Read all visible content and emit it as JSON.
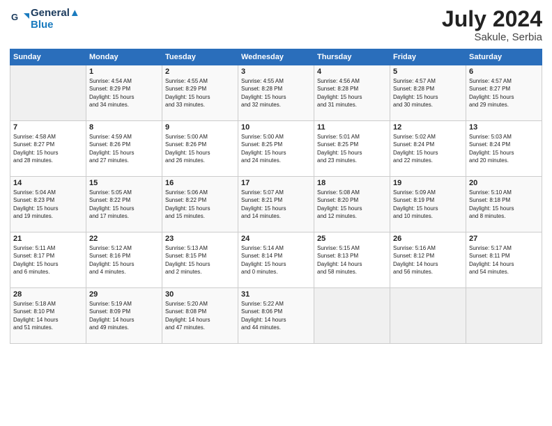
{
  "header": {
    "logo_line1": "General",
    "logo_line2": "Blue",
    "month_year": "July 2024",
    "location": "Sakule, Serbia"
  },
  "columns": [
    "Sunday",
    "Monday",
    "Tuesday",
    "Wednesday",
    "Thursday",
    "Friday",
    "Saturday"
  ],
  "weeks": [
    [
      {
        "day": "",
        "info": ""
      },
      {
        "day": "1",
        "info": "Sunrise: 4:54 AM\nSunset: 8:29 PM\nDaylight: 15 hours\nand 34 minutes."
      },
      {
        "day": "2",
        "info": "Sunrise: 4:55 AM\nSunset: 8:29 PM\nDaylight: 15 hours\nand 33 minutes."
      },
      {
        "day": "3",
        "info": "Sunrise: 4:55 AM\nSunset: 8:28 PM\nDaylight: 15 hours\nand 32 minutes."
      },
      {
        "day": "4",
        "info": "Sunrise: 4:56 AM\nSunset: 8:28 PM\nDaylight: 15 hours\nand 31 minutes."
      },
      {
        "day": "5",
        "info": "Sunrise: 4:57 AM\nSunset: 8:28 PM\nDaylight: 15 hours\nand 30 minutes."
      },
      {
        "day": "6",
        "info": "Sunrise: 4:57 AM\nSunset: 8:27 PM\nDaylight: 15 hours\nand 29 minutes."
      }
    ],
    [
      {
        "day": "7",
        "info": "Sunrise: 4:58 AM\nSunset: 8:27 PM\nDaylight: 15 hours\nand 28 minutes."
      },
      {
        "day": "8",
        "info": "Sunrise: 4:59 AM\nSunset: 8:26 PM\nDaylight: 15 hours\nand 27 minutes."
      },
      {
        "day": "9",
        "info": "Sunrise: 5:00 AM\nSunset: 8:26 PM\nDaylight: 15 hours\nand 26 minutes."
      },
      {
        "day": "10",
        "info": "Sunrise: 5:00 AM\nSunset: 8:25 PM\nDaylight: 15 hours\nand 24 minutes."
      },
      {
        "day": "11",
        "info": "Sunrise: 5:01 AM\nSunset: 8:25 PM\nDaylight: 15 hours\nand 23 minutes."
      },
      {
        "day": "12",
        "info": "Sunrise: 5:02 AM\nSunset: 8:24 PM\nDaylight: 15 hours\nand 22 minutes."
      },
      {
        "day": "13",
        "info": "Sunrise: 5:03 AM\nSunset: 8:24 PM\nDaylight: 15 hours\nand 20 minutes."
      }
    ],
    [
      {
        "day": "14",
        "info": "Sunrise: 5:04 AM\nSunset: 8:23 PM\nDaylight: 15 hours\nand 19 minutes."
      },
      {
        "day": "15",
        "info": "Sunrise: 5:05 AM\nSunset: 8:22 PM\nDaylight: 15 hours\nand 17 minutes."
      },
      {
        "day": "16",
        "info": "Sunrise: 5:06 AM\nSunset: 8:22 PM\nDaylight: 15 hours\nand 15 minutes."
      },
      {
        "day": "17",
        "info": "Sunrise: 5:07 AM\nSunset: 8:21 PM\nDaylight: 15 hours\nand 14 minutes."
      },
      {
        "day": "18",
        "info": "Sunrise: 5:08 AM\nSunset: 8:20 PM\nDaylight: 15 hours\nand 12 minutes."
      },
      {
        "day": "19",
        "info": "Sunrise: 5:09 AM\nSunset: 8:19 PM\nDaylight: 15 hours\nand 10 minutes."
      },
      {
        "day": "20",
        "info": "Sunrise: 5:10 AM\nSunset: 8:18 PM\nDaylight: 15 hours\nand 8 minutes."
      }
    ],
    [
      {
        "day": "21",
        "info": "Sunrise: 5:11 AM\nSunset: 8:17 PM\nDaylight: 15 hours\nand 6 minutes."
      },
      {
        "day": "22",
        "info": "Sunrise: 5:12 AM\nSunset: 8:16 PM\nDaylight: 15 hours\nand 4 minutes."
      },
      {
        "day": "23",
        "info": "Sunrise: 5:13 AM\nSunset: 8:15 PM\nDaylight: 15 hours\nand 2 minutes."
      },
      {
        "day": "24",
        "info": "Sunrise: 5:14 AM\nSunset: 8:14 PM\nDaylight: 15 hours\nand 0 minutes."
      },
      {
        "day": "25",
        "info": "Sunrise: 5:15 AM\nSunset: 8:13 PM\nDaylight: 14 hours\nand 58 minutes."
      },
      {
        "day": "26",
        "info": "Sunrise: 5:16 AM\nSunset: 8:12 PM\nDaylight: 14 hours\nand 56 minutes."
      },
      {
        "day": "27",
        "info": "Sunrise: 5:17 AM\nSunset: 8:11 PM\nDaylight: 14 hours\nand 54 minutes."
      }
    ],
    [
      {
        "day": "28",
        "info": "Sunrise: 5:18 AM\nSunset: 8:10 PM\nDaylight: 14 hours\nand 51 minutes."
      },
      {
        "day": "29",
        "info": "Sunrise: 5:19 AM\nSunset: 8:09 PM\nDaylight: 14 hours\nand 49 minutes."
      },
      {
        "day": "30",
        "info": "Sunrise: 5:20 AM\nSunset: 8:08 PM\nDaylight: 14 hours\nand 47 minutes."
      },
      {
        "day": "31",
        "info": "Sunrise: 5:22 AM\nSunset: 8:06 PM\nDaylight: 14 hours\nand 44 minutes."
      },
      {
        "day": "",
        "info": ""
      },
      {
        "day": "",
        "info": ""
      },
      {
        "day": "",
        "info": ""
      }
    ]
  ]
}
